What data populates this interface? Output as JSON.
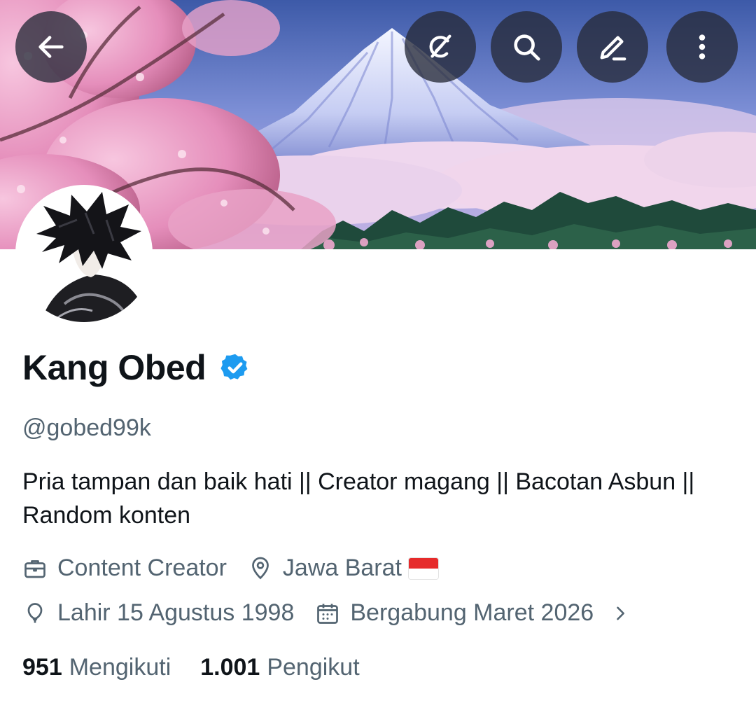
{
  "header": {
    "icons": [
      "back-arrow-icon",
      "grok-icon",
      "search-icon",
      "edit-pencil-icon",
      "more-vertical-icon"
    ]
  },
  "profile": {
    "name": "Kang Obed",
    "handle": "@gobed99k",
    "bio": "Pria tampan dan baik hati || Creator magang || Bacotan Asbun || Random konten",
    "verified_color": "#1d9bf0",
    "category": "Content Creator",
    "location": "Jawa Barat",
    "birthday": "Lahir 15 Agustus 1998",
    "joined": "Bergabung Maret 2026",
    "following_count": "951",
    "following_label": "Mengikuti",
    "followers_count": "1.001",
    "followers_label": "Pengikut"
  },
  "colors": {
    "text_primary": "#0f1419",
    "text_secondary": "#536471",
    "accent": "#1d9bf0"
  }
}
